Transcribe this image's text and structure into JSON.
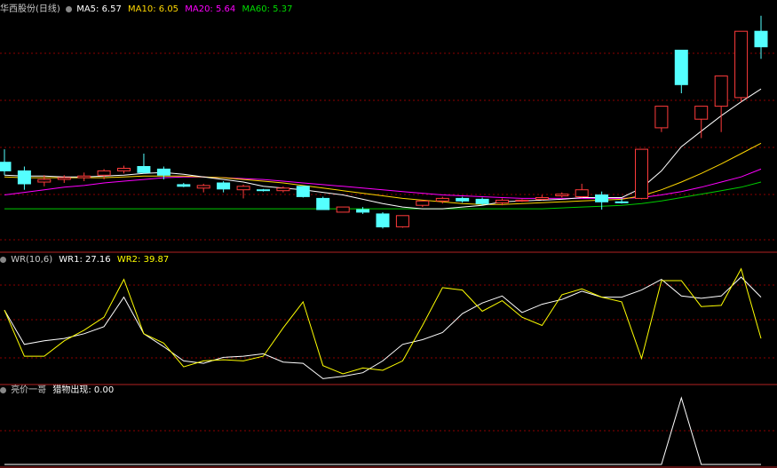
{
  "panel_main": {
    "title": "华西股份(日线)",
    "indicators": [
      {
        "label": "MA5: 6.57",
        "color": "#ffffff"
      },
      {
        "label": "MA10: 6.05",
        "color": "#ffd700"
      },
      {
        "label": "MA20: 5.64",
        "color": "#ff00ff"
      },
      {
        "label": "MA60: 5.37",
        "color": "#00dd00"
      }
    ]
  },
  "panel_wr": {
    "title": "WR(10,6)",
    "wr1": "WR1: 27.16",
    "wr2": "WR2: 39.87"
  },
  "panel_signal": {
    "title": "亮价一哥",
    "value": "猎物出现: 0.00"
  },
  "colors": {
    "up": "#ff3b3b",
    "down": "#54ffff",
    "grid": "#8b0000",
    "ma5": "#ffffff",
    "ma10": "#ffd700",
    "ma20": "#ff00ff",
    "ma60": "#00cc00",
    "wr1": "#ffffff",
    "wr2": "#ffff00"
  },
  "chart_data": {
    "type": "candlestick",
    "candles": [
      {
        "o": 5.4,
        "c": 5.3,
        "h": 5.55,
        "l": 5.25
      },
      {
        "o": 5.3,
        "c": 5.15,
        "h": 5.35,
        "l": 5.08
      },
      {
        "o": 5.17,
        "c": 5.2,
        "h": 5.25,
        "l": 5.12
      },
      {
        "o": 5.2,
        "c": 5.22,
        "h": 5.25,
        "l": 5.16
      },
      {
        "o": 5.22,
        "c": 5.24,
        "h": 5.28,
        "l": 5.18
      },
      {
        "o": 5.25,
        "c": 5.3,
        "h": 5.32,
        "l": 5.2
      },
      {
        "o": 5.3,
        "c": 5.33,
        "h": 5.36,
        "l": 5.27
      },
      {
        "o": 5.35,
        "c": 5.28,
        "h": 5.5,
        "l": 5.27
      },
      {
        "o": 5.32,
        "c": 5.25,
        "h": 5.35,
        "l": 5.2
      },
      {
        "o": 5.14,
        "c": 5.12,
        "h": 5.16,
        "l": 5.11
      },
      {
        "o": 5.1,
        "c": 5.13,
        "h": 5.15,
        "l": 5.05
      },
      {
        "o": 5.16,
        "c": 5.09,
        "h": 5.18,
        "l": 5.05
      },
      {
        "o": 5.08,
        "c": 5.12,
        "h": 5.14,
        "l": 4.98
      },
      {
        "o": 5.08,
        "c": 5.07,
        "h": 5.09,
        "l": 5.06
      },
      {
        "o": 5.07,
        "c": 5.1,
        "h": 5.12,
        "l": 5.05
      },
      {
        "o": 5.12,
        "c": 5.0,
        "h": 5.12,
        "l": 4.99
      },
      {
        "o": 4.98,
        "c": 4.85,
        "h": 5.0,
        "l": 4.85
      },
      {
        "o": 4.82,
        "c": 4.88,
        "h": 4.88,
        "l": 4.82
      },
      {
        "o": 4.85,
        "c": 4.82,
        "h": 4.88,
        "l": 4.8
      },
      {
        "o": 4.8,
        "c": 4.65,
        "h": 4.82,
        "l": 4.63
      },
      {
        "o": 4.65,
        "c": 4.78,
        "h": 4.78,
        "l": 4.64
      },
      {
        "o": 4.9,
        "c": 4.95,
        "h": 4.95,
        "l": 4.88
      },
      {
        "o": 4.95,
        "c": 4.98,
        "h": 5.0,
        "l": 4.92
      },
      {
        "o": 4.98,
        "c": 4.95,
        "h": 5.0,
        "l": 4.93
      },
      {
        "o": 4.97,
        "c": 4.92,
        "h": 4.99,
        "l": 4.9
      },
      {
        "o": 4.93,
        "c": 4.96,
        "h": 4.98,
        "l": 4.9
      },
      {
        "o": 4.95,
        "c": 4.96,
        "h": 4.97,
        "l": 4.94
      },
      {
        "o": 4.97,
        "c": 4.99,
        "h": 5.02,
        "l": 4.96
      },
      {
        "o": 5.01,
        "c": 5.03,
        "h": 5.05,
        "l": 4.99
      },
      {
        "o": 5.0,
        "c": 5.08,
        "h": 5.15,
        "l": 4.99
      },
      {
        "o": 5.02,
        "c": 4.94,
        "h": 5.06,
        "l": 4.85
      },
      {
        "o": 4.94,
        "c": 4.93,
        "h": 4.98,
        "l": 4.92
      },
      {
        "o": 4.98,
        "c": 5.55,
        "h": 5.55,
        "l": 4.97
      },
      {
        "o": 5.8,
        "c": 6.05,
        "h": 6.05,
        "l": 5.75
      },
      {
        "o": 6.7,
        "c": 6.3,
        "h": 6.7,
        "l": 6.2
      },
      {
        "o": 5.9,
        "c": 6.05,
        "h": 6.05,
        "l": 5.68
      },
      {
        "o": 6.05,
        "c": 6.4,
        "h": 6.4,
        "l": 5.75
      },
      {
        "o": 6.15,
        "c": 6.92,
        "h": 6.92,
        "l": 6.1
      },
      {
        "o": 6.92,
        "c": 6.74,
        "h": 7.1,
        "l": 6.6
      }
    ],
    "ma5": [
      5.25,
      5.24,
      5.24,
      5.23,
      5.23,
      5.24,
      5.25,
      5.27,
      5.28,
      5.26,
      5.23,
      5.2,
      5.17,
      5.12,
      5.1,
      5.08,
      5.05,
      5.02,
      4.97,
      4.92,
      4.88,
      4.86,
      4.86,
      4.88,
      4.9,
      4.94,
      4.95,
      4.96,
      4.97,
      4.99,
      4.99,
      4.99,
      5.1,
      5.3,
      5.58,
      5.76,
      5.94,
      6.1,
      6.25
    ],
    "ma10": [
      5.23,
      5.22,
      5.22,
      5.22,
      5.22,
      5.22,
      5.23,
      5.24,
      5.24,
      5.24,
      5.23,
      5.22,
      5.2,
      5.18,
      5.16,
      5.13,
      5.1,
      5.07,
      5.04,
      5.01,
      4.98,
      4.96,
      4.94,
      4.92,
      4.91,
      4.91,
      4.92,
      4.93,
      4.94,
      4.95,
      4.96,
      4.97,
      5.01,
      5.08,
      5.17,
      5.27,
      5.38,
      5.5,
      5.62
    ],
    "ma20": [
      5.02,
      5.05,
      5.08,
      5.11,
      5.13,
      5.16,
      5.18,
      5.2,
      5.22,
      5.23,
      5.23,
      5.22,
      5.21,
      5.2,
      5.18,
      5.16,
      5.14,
      5.12,
      5.1,
      5.08,
      5.06,
      5.04,
      5.02,
      5.01,
      5.0,
      4.99,
      4.98,
      4.98,
      4.98,
      4.98,
      4.98,
      4.98,
      4.99,
      5.02,
      5.06,
      5.11,
      5.17,
      5.23,
      5.32
    ],
    "ma60": [
      4.86,
      4.86,
      4.86,
      4.86,
      4.86,
      4.86,
      4.86,
      4.86,
      4.86,
      4.86,
      4.86,
      4.86,
      4.86,
      4.86,
      4.86,
      4.86,
      4.86,
      4.86,
      4.86,
      4.86,
      4.86,
      4.86,
      4.86,
      4.86,
      4.86,
      4.86,
      4.86,
      4.86,
      4.87,
      4.88,
      4.89,
      4.9,
      4.92,
      4.95,
      4.99,
      5.03,
      5.07,
      5.11,
      5.17
    ],
    "wr1": [
      37,
      66,
      63,
      61,
      57,
      51,
      26,
      57,
      68,
      80,
      82,
      77,
      76,
      74,
      81,
      82,
      95,
      93,
      90,
      80,
      66,
      62,
      56,
      40,
      31,
      25,
      39,
      32,
      28,
      21,
      26,
      26,
      20,
      11,
      25,
      27,
      25,
      9,
      26
    ],
    "wr2": [
      37,
      76,
      76,
      63,
      54,
      43,
      11,
      57,
      65,
      85,
      80,
      79,
      80,
      76,
      52,
      30,
      84,
      91,
      86,
      88,
      80,
      50,
      18,
      20,
      38,
      29,
      43,
      50,
      24,
      19,
      26,
      30,
      78,
      12,
      12,
      34,
      33,
      2,
      61
    ],
    "signal": [
      0,
      0,
      0,
      0,
      0,
      0,
      0,
      0,
      0,
      0,
      0,
      0,
      0,
      0,
      0,
      0,
      0,
      0,
      0,
      0,
      0,
      0,
      0,
      0,
      0,
      0,
      0,
      0,
      0,
      0,
      0,
      0,
      0,
      0,
      100,
      0,
      0,
      0,
      0
    ]
  }
}
